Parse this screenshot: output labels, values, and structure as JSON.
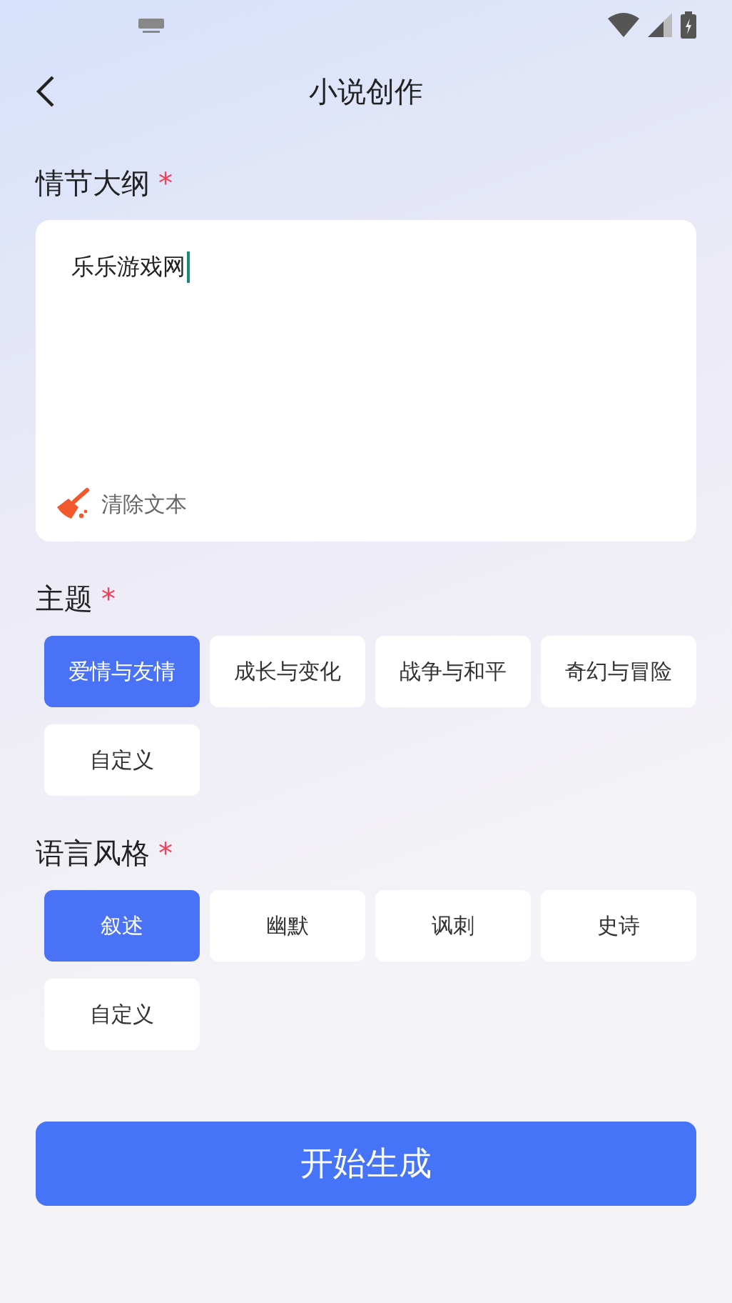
{
  "header": {
    "title": "小说创作"
  },
  "outline": {
    "label": "情节大纲",
    "required": "*",
    "value": "乐乐游戏网",
    "clear_label": "清除文本"
  },
  "theme": {
    "label": "主题",
    "required": "*",
    "options": [
      {
        "label": "爱情与友情",
        "selected": true
      },
      {
        "label": "成长与变化",
        "selected": false
      },
      {
        "label": "战争与和平",
        "selected": false
      },
      {
        "label": "奇幻与冒险",
        "selected": false
      },
      {
        "label": "自定义",
        "selected": false
      }
    ]
  },
  "style": {
    "label": "语言风格",
    "required": "*",
    "options": [
      {
        "label": "叙述",
        "selected": true
      },
      {
        "label": "幽默",
        "selected": false
      },
      {
        "label": "讽刺",
        "selected": false
      },
      {
        "label": "史诗",
        "selected": false
      },
      {
        "label": "自定义",
        "selected": false
      }
    ]
  },
  "submit": {
    "label": "开始生成"
  }
}
